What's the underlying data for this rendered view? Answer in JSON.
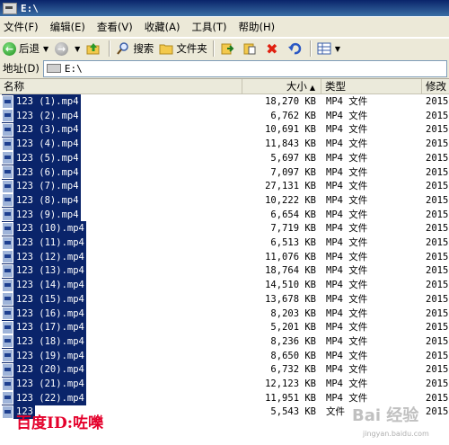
{
  "window": {
    "title": "E:\\"
  },
  "menu": [
    "文件(F)",
    "编辑(E)",
    "查看(V)",
    "收藏(A)",
    "工具(T)",
    "帮助(H)"
  ],
  "toolbar": {
    "back_label": "后退",
    "search_label": "搜索",
    "folders_label": "文件夹"
  },
  "address": {
    "label": "地址(D)",
    "path": "E:\\"
  },
  "columns": {
    "name": "名称",
    "size": "大小",
    "type": "类型",
    "date": "修改"
  },
  "files": [
    {
      "name": "123 (1).mp4",
      "size": "18,270 KB",
      "type": "MP4 文件",
      "date": "2015-"
    },
    {
      "name": "123 (2).mp4",
      "size": "6,762 KB",
      "type": "MP4 文件",
      "date": "2015-"
    },
    {
      "name": "123 (3).mp4",
      "size": "10,691 KB",
      "type": "MP4 文件",
      "date": "2015-"
    },
    {
      "name": "123 (4).mp4",
      "size": "11,843 KB",
      "type": "MP4 文件",
      "date": "2015-"
    },
    {
      "name": "123 (5).mp4",
      "size": "5,697 KB",
      "type": "MP4 文件",
      "date": "2015-"
    },
    {
      "name": "123 (6).mp4",
      "size": "7,097 KB",
      "type": "MP4 文件",
      "date": "2015-"
    },
    {
      "name": "123 (7).mp4",
      "size": "27,131 KB",
      "type": "MP4 文件",
      "date": "2015-"
    },
    {
      "name": "123 (8).mp4",
      "size": "10,222 KB",
      "type": "MP4 文件",
      "date": "2015-"
    },
    {
      "name": "123 (9).mp4",
      "size": "6,654 KB",
      "type": "MP4 文件",
      "date": "2015-"
    },
    {
      "name": "123 (10).mp4",
      "size": "7,719 KB",
      "type": "MP4 文件",
      "date": "2015-"
    },
    {
      "name": "123 (11).mp4",
      "size": "6,513 KB",
      "type": "MP4 文件",
      "date": "2015-"
    },
    {
      "name": "123 (12).mp4",
      "size": "11,076 KB",
      "type": "MP4 文件",
      "date": "2015-"
    },
    {
      "name": "123 (13).mp4",
      "size": "18,764 KB",
      "type": "MP4 文件",
      "date": "2015-"
    },
    {
      "name": "123 (14).mp4",
      "size": "14,510 KB",
      "type": "MP4 文件",
      "date": "2015-"
    },
    {
      "name": "123 (15).mp4",
      "size": "13,678 KB",
      "type": "MP4 文件",
      "date": "2015-"
    },
    {
      "name": "123 (16).mp4",
      "size": "8,203 KB",
      "type": "MP4 文件",
      "date": "2015-"
    },
    {
      "name": "123 (17).mp4",
      "size": "5,201 KB",
      "type": "MP4 文件",
      "date": "2015-"
    },
    {
      "name": "123 (18).mp4",
      "size": "8,236 KB",
      "type": "MP4 文件",
      "date": "2015-"
    },
    {
      "name": "123 (19).mp4",
      "size": "8,650 KB",
      "type": "MP4 文件",
      "date": "2015-"
    },
    {
      "name": "123 (20).mp4",
      "size": "6,732 KB",
      "type": "MP4 文件",
      "date": "2015-"
    },
    {
      "name": "123 (21).mp4",
      "size": "12,123 KB",
      "type": "MP4 文件",
      "date": "2015-"
    },
    {
      "name": "123 (22).mp4",
      "size": "11,951 KB",
      "type": "MP4 文件",
      "date": "2015-"
    },
    {
      "name": "123",
      "size": "5,543 KB",
      "type": "文件",
      "date": "2015-"
    }
  ],
  "overlay": {
    "caption": "百度ID:咗嚛",
    "brand": "Bai 经验",
    "brand_sub": "jingyan.baidu.com"
  }
}
